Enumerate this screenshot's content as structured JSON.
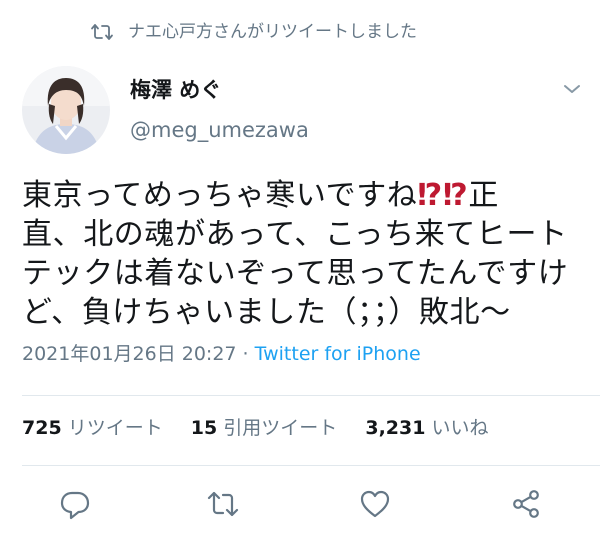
{
  "retweet_header": {
    "text": "ナエ心戸方さんがリツイートしました",
    "icon": "retweet-icon"
  },
  "author": {
    "name": "梅澤 めぐ",
    "handle": "@meg_umezawa",
    "avatar": "avatar"
  },
  "tweet": {
    "line1_a": "東京ってめっちゃ寒いですね",
    "line1_exq": "⁉⁉",
    "line1_b": "正",
    "line2": "直、北の魂があって、こっち来てヒート",
    "line3": "テックは着ないぞって思ってたんですけ",
    "line4": "ど、負けちゃいました（；；）敗北〜"
  },
  "meta": {
    "datetime": "2021年01月26日 20:27",
    "separator": " · ",
    "source": "Twitter for iPhone"
  },
  "stats": {
    "retweets_count": "725",
    "retweets_label": "リツイート",
    "quotes_count": "15",
    "quotes_label": "引用ツイート",
    "likes_count": "3,231",
    "likes_label": "いいね"
  },
  "actions": [
    "reply-icon",
    "retweet-icon",
    "like-icon",
    "share-icon"
  ],
  "colors": {
    "secondary": "#657786",
    "link": "#1da1f2",
    "divider": "#e1e8ed",
    "text": "#14171a",
    "emoji": "#be1931"
  }
}
